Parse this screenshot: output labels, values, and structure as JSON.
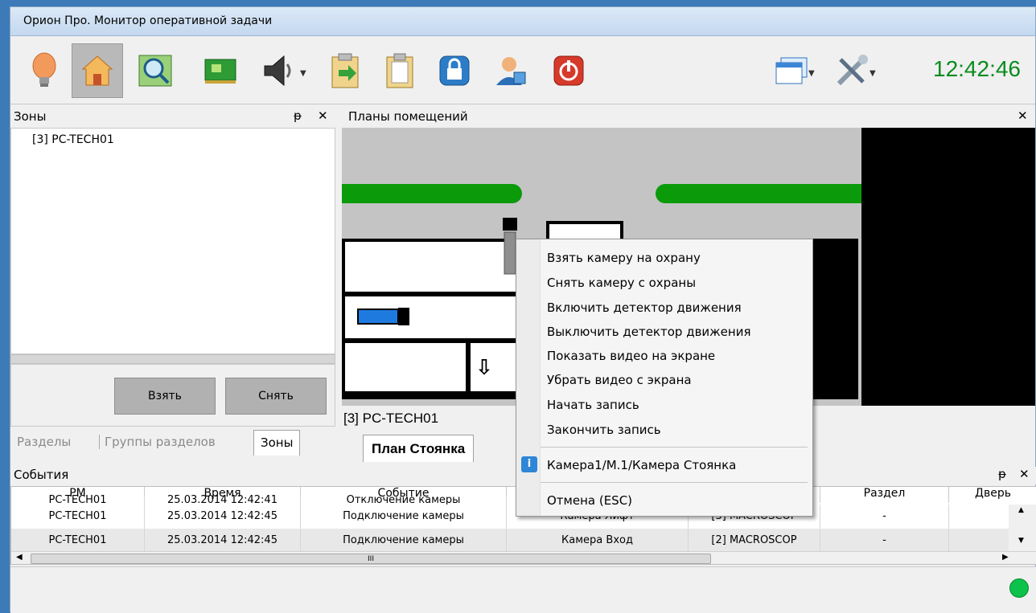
{
  "window": {
    "title": "Орион Про. Монитор оперативной задачи"
  },
  "toolbar": {
    "icons": [
      "lamp-icon",
      "home-icon",
      "map-search-icon",
      "board-icon",
      "speaker-icon",
      "export-icon",
      "clipboard-icon",
      "lock-icon",
      "user-icon",
      "power-icon",
      "windows-icon",
      "tools-icon"
    ],
    "clock": "12:42:46"
  },
  "zones_panel": {
    "title": "Зоны",
    "item": "[3] PC-TECH01",
    "take_button": "Взять",
    "remove_button": "Снять"
  },
  "left_tabs": [
    "Разделы",
    "Группы разделов",
    "Зоны"
  ],
  "plans_panel": {
    "title": "Планы помещений",
    "location_label": "[3] PC-TECH01",
    "tab": "План Стоянка"
  },
  "context_menu": {
    "items": [
      "Взять камеру на охрану",
      "Снять камеру с охраны",
      "Включить детектор движения",
      "Выключить детектор движения",
      "Показать видео на экране",
      "Убрать видео с экрана",
      "Начать запись",
      "Закончить запись"
    ],
    "camera_item": "Камера1/М.1/Камера Стоянка",
    "cancel": "Отмена (ESC)"
  },
  "events_panel": {
    "title": "События",
    "columns": [
      "РМ",
      "Время",
      "Событие",
      "",
      "",
      "Раздел",
      "Дверь"
    ],
    "partial_row": [
      "PC-TECH01",
      "25.03.2014 12:42:41",
      "Отключение камеры"
    ],
    "rows": [
      [
        "PC-TECH01",
        "25.03.2014 12:42:45",
        "Подключение камеры",
        "Камера Лифт",
        "[3] MACROSCOP",
        "-"
      ],
      [
        "PC-TECH01",
        "25.03.2014 12:42:45",
        "Подключение камеры",
        "Камера Вход",
        "[2] MACROSCOP",
        "-"
      ]
    ],
    "scroll_marker": "III"
  },
  "colors": {
    "clock": "#0a8c1e",
    "status_ok": "#0cc24a",
    "plan_green": "#0a9a0a"
  }
}
